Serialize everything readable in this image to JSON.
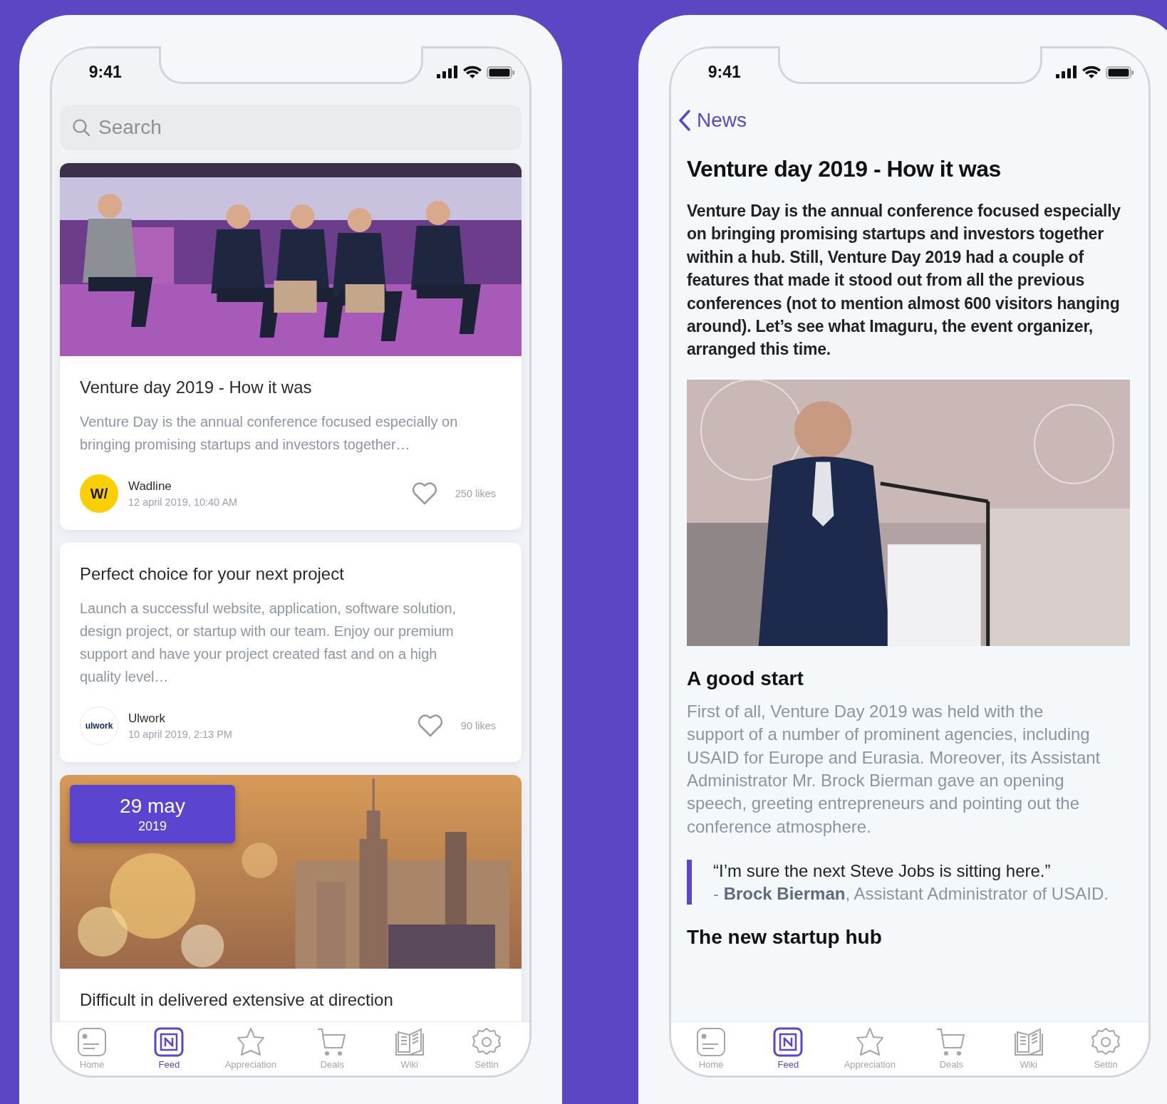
{
  "screens": [
    {
      "kind": "feed",
      "status_time": "9:41",
      "search": {
        "placeholder": "Search"
      },
      "posts": [
        {
          "title": "Venture day 2019 - How it was",
          "excerpt": "Venture Day is the annual conference focused especially on bringing promising startups and investors together…",
          "author": {
            "kind": "wadline",
            "logo": "W/",
            "name": "Wadline"
          },
          "date": "12 april 2019, 10:40 AM",
          "likes": "250 likes"
        },
        {
          "kind": "text",
          "title": "Perfect choice for your next project",
          "excerpt": "Launch a successful website, application, software solution, design project, or startup with our team. Enjoy our premium support and have your project created fast and on a high quality level…",
          "author": {
            "kind": "ulwork",
            "logo": "ulwork",
            "name": "Ulwork"
          },
          "date": "10 april 2019, 2:13 PM",
          "likes": "90 likes"
        },
        {
          "kind": "event",
          "badge": {
            "day": "29 may",
            "year": "2019"
          },
          "title": "Difficult in delivered extensive at direction"
        }
      ],
      "tab_bar": [
        {
          "kind": "home",
          "label": "Home",
          "selected": false
        },
        {
          "kind": "feed",
          "label": "Feed",
          "selected": true
        },
        {
          "kind": "star",
          "label": "Appreciation",
          "selected": false
        },
        {
          "kind": "cart",
          "label": "Deals",
          "selected": false
        },
        {
          "kind": "book",
          "label": "Wiki",
          "selected": false
        },
        {
          "kind": "gear",
          "label": "Settin",
          "selected": false
        }
      ]
    },
    {
      "kind": "article",
      "status_time": "9:41",
      "back": "News",
      "title": "Venture day 2019 - How it was",
      "lead": "Venture Day is the annual conference focused especially on bringing promising startups and investors together within a hub. Still, Venture Day 2019 had a couple of features that made it stood out from all the previous conferences (not to mention almost 600 visitors hanging around). Let’s see what Imaguru, the event organizer, arranged this time.",
      "sections": [
        {
          "heading": "A good start",
          "text": "First of all, Venture Day 2019 was held with the support of a number of prominent agencies, including USAID for Europe and Eurasia. Moreover, its Assistant Administrator Mr. Brock Bierman gave an opening speech, greeting entrepreneurs and pointing out the conference atmosphere.",
          "quote": "“I’m sure the next Steve Jobs is sitting here.”",
          "attribution": "- **Brock Bierman**, Assistant Administrator of USAID."
        },
        {
          "heading": "The new startup hub"
        }
      ],
      "tab_bar": [
        {
          "kind": "home",
          "label": "Home",
          "selected": false
        },
        {
          "kind": "feed",
          "label": "Feed",
          "selected": true
        },
        {
          "kind": "star",
          "label": "Appreciation",
          "selected": false
        },
        {
          "kind": "cart",
          "label": "Deals",
          "selected": false
        },
        {
          "kind": "book",
          "label": "Wiki",
          "selected": false
        },
        {
          "kind": "gear",
          "label": "Settin",
          "selected": false
        }
      ]
    }
  ]
}
